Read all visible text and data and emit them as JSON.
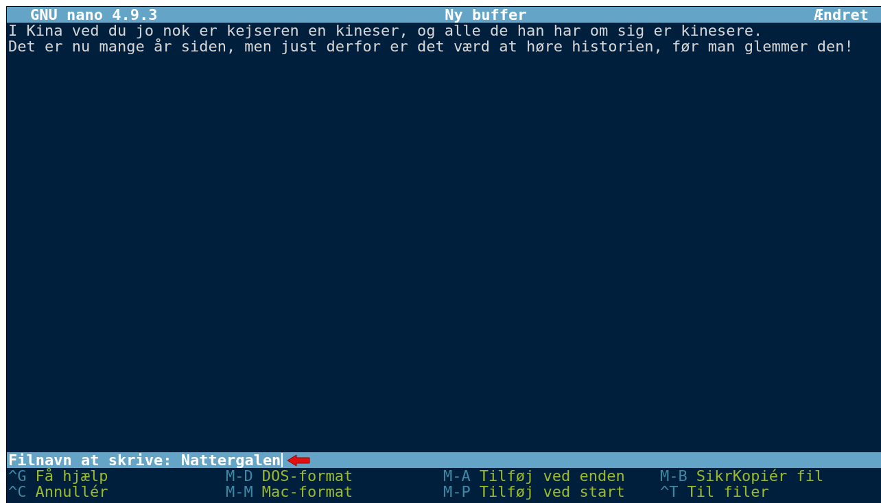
{
  "title_bar": {
    "app": "GNU nano 4.9.3",
    "buffer": "Ny buffer",
    "state": "Ændret"
  },
  "editor": {
    "lines": [
      "I Kina ved du jo nok er kejseren en kineser, og alle de han har om sig er kinesere.",
      "Det er nu mange år siden, men just derfor er det værd at høre historien, før man glemmer den!"
    ]
  },
  "prompt": {
    "label": "Filnavn at skrive:",
    "value": "Nattergalen"
  },
  "shortcuts": [
    [
      {
        "key": "^G",
        "label": "Få hjælp"
      },
      {
        "key": "M-D",
        "label": "DOS-format"
      },
      {
        "key": "M-A",
        "label": "Tilføj ved enden"
      },
      {
        "key": "M-B",
        "label": "SikrKopiér fil"
      }
    ],
    [
      {
        "key": "^C",
        "label": "Annullér"
      },
      {
        "key": "M-M",
        "label": "Mac-format"
      },
      {
        "key": "M-P",
        "label": "Tilføj ved start"
      },
      {
        "key": "^T",
        "label": "Til filer"
      }
    ]
  ]
}
